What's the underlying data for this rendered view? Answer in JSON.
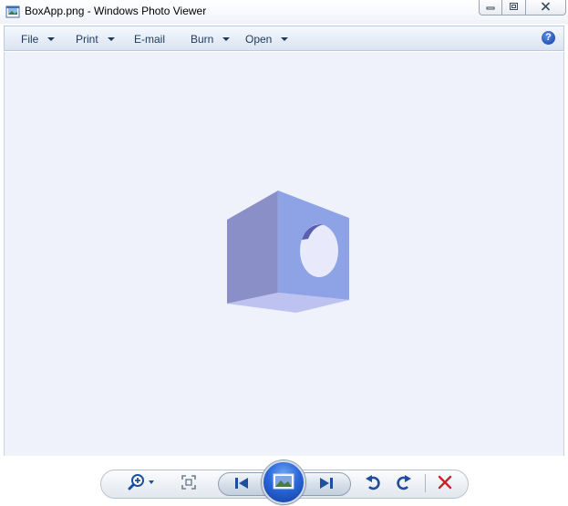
{
  "window": {
    "title": "BoxApp.png - Windows Photo Viewer",
    "icon": "photo-viewer-icon"
  },
  "caption_buttons": {
    "minimize_icon": "minimize-icon",
    "restore_icon": "restore-icon",
    "close_icon": "close-icon"
  },
  "menu": {
    "items": [
      {
        "label": "File",
        "has_dropdown": true
      },
      {
        "label": "Print",
        "has_dropdown": true
      },
      {
        "label": "E-mail",
        "has_dropdown": false
      },
      {
        "label": "Burn",
        "has_dropdown": true
      },
      {
        "label": "Open",
        "has_dropdown": true
      }
    ],
    "help_label": "?"
  },
  "viewer": {
    "background": "#eff2fa",
    "image_subject": "3d-box-image"
  },
  "toolbar": {
    "buttons": [
      {
        "name": "zoom-button",
        "icon": "magnifier-plus-icon"
      },
      {
        "name": "actual-size-button",
        "icon": "fit-window-icon"
      },
      {
        "name": "previous-button",
        "icon": "skip-previous-icon"
      },
      {
        "name": "slideshow-button",
        "icon": "slideshow-icon"
      },
      {
        "name": "next-button",
        "icon": "skip-next-icon"
      },
      {
        "name": "rotate-counterclockwise-button",
        "icon": "rotate-left-icon"
      },
      {
        "name": "rotate-clockwise-button",
        "icon": "rotate-right-icon"
      },
      {
        "name": "delete-button",
        "icon": "delete-x-icon"
      }
    ]
  },
  "colors": {
    "accent_blue": "#2356b8",
    "delete_red": "#c8232c",
    "menu_text": "#1e395b"
  }
}
